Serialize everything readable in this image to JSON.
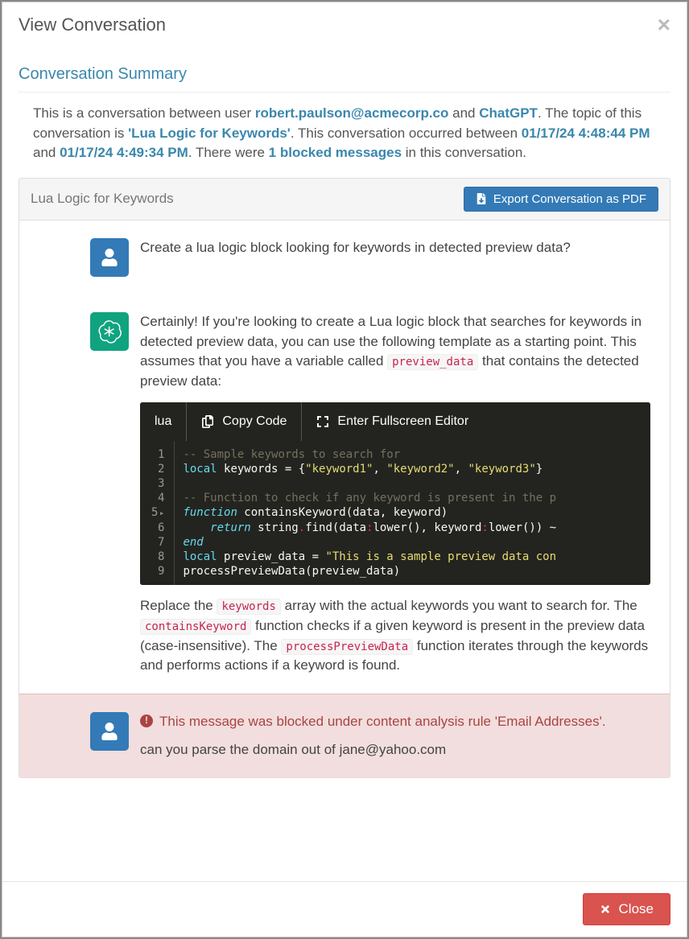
{
  "modal": {
    "title": "View Conversation",
    "close_label": "Close"
  },
  "summary": {
    "heading": "Conversation Summary",
    "prefix": "This is a conversation between user ",
    "user_email": "robert.paulson@acmecorp.co",
    "mid1": " and ",
    "ai_name": "ChatGPT",
    "mid2": ". The topic of this conversation is ",
    "topic": "'Lua Logic for Keywords'",
    "mid3": ". This conversation occurred between ",
    "start_time": "01/17/24 4:48:44 PM",
    "mid4": " and ",
    "end_time": "01/17/24 4:49:34 PM",
    "mid5": ". There were ",
    "blocked_count": "1 blocked messages",
    "suffix": " in this conversation."
  },
  "panel": {
    "title": "Lua Logic for Keywords",
    "export_label": "Export Conversation as PDF"
  },
  "messages": {
    "m1": {
      "text": "Create a lua logic block looking for keywords in detected preview data?"
    },
    "m2": {
      "intro_a": "Certainly! If you're looking to create a Lua logic block that searches for keywords in detected preview data, you can use the following template as a starting point. This assumes that you have a variable called ",
      "intro_code": "preview_data",
      "intro_b": " that contains the detected preview data:",
      "code_lang": "lua",
      "copy_label": "Copy Code",
      "fullscreen_label": "Enter Fullscreen Editor",
      "code_lines": {
        "l1": "-- Sample keywords to search for",
        "l2a": "local",
        "l2b": " keywords = {",
        "l2c": "\"keyword1\"",
        "l2d": ", ",
        "l2e": "\"keyword2\"",
        "l2f": ", ",
        "l2g": "\"keyword3\"",
        "l2h": "}",
        "l3": "",
        "l4": "-- Function to check if any keyword is present in the p",
        "l5a": "function",
        "l5b": " containsKeyword(data, keyword)",
        "l6a": "    return",
        "l6b": " string",
        "l6c": ".",
        "l6d": "find",
        "l6e": "(data",
        "l6f": ":",
        "l6g": "lower",
        "l6h": "(), keyword",
        "l6i": ":",
        "l6j": "lower",
        "l6k": "()) ~",
        "l7": "end",
        "l8a": "local",
        "l8b": " preview_data = ",
        "l8c": "\"This is a sample preview data con",
        "l9": "processPreviewData(preview_data)"
      },
      "outro_a": "Replace the ",
      "outro_code1": "keywords",
      "outro_b": " array with the actual keywords you want to search for. The ",
      "outro_code2": "containsKeyword",
      "outro_c": " function checks if a given keyword is present in the preview data (case-insensitive). The ",
      "outro_code3": "processPreviewData",
      "outro_d": " function iterates through the keywords and performs actions if a keyword is found."
    },
    "m3": {
      "warn": "This message was blocked under content analysis rule 'Email Addresses'.",
      "text": "can you parse the domain out of jane@yahoo.com"
    }
  }
}
